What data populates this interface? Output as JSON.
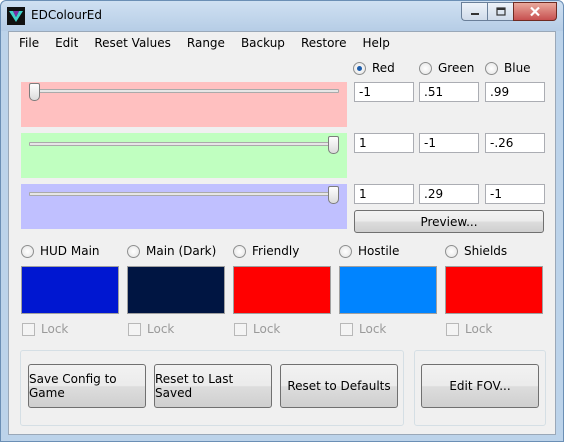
{
  "window": {
    "title": "EDColourEd",
    "buttons": {
      "minimize": "minimize-icon",
      "maximize": "maximize-icon",
      "close": "close-icon"
    }
  },
  "menu": [
    "File",
    "Edit",
    "Reset Values",
    "Range",
    "Backup",
    "Restore",
    "Help"
  ],
  "channels": {
    "selected": "Red",
    "labels": [
      "Red",
      "Green",
      "Blue"
    ]
  },
  "sliders": [
    {
      "name": "red",
      "value": 0.0,
      "color": "#ffc0c0"
    },
    {
      "name": "green",
      "value": 1.0,
      "color": "#c0ffc0"
    },
    {
      "name": "blue",
      "value": 1.0,
      "color": "#c0c0ff"
    }
  ],
  "matrix": [
    [
      "-1",
      ".51",
      ".99"
    ],
    [
      "1",
      "-1",
      "-.26"
    ],
    [
      "1",
      ".29",
      "-1"
    ]
  ],
  "preview_label": "Preview...",
  "elements": [
    {
      "label": "HUD Main",
      "color": "#0017d1",
      "selected": false,
      "lock": "Lock"
    },
    {
      "label": "Main (Dark)",
      "color": "#001542",
      "selected": false,
      "lock": "Lock"
    },
    {
      "label": "Friendly",
      "color": "#ff0000",
      "selected": false,
      "lock": "Lock"
    },
    {
      "label": "Hostile",
      "color": "#0084ff",
      "selected": false,
      "lock": "Lock"
    },
    {
      "label": "Shields",
      "color": "#ff0000",
      "selected": false,
      "lock": "Lock"
    }
  ],
  "actions": {
    "save": "Save Config to Game",
    "reset_last": "Reset to Last Saved",
    "reset_defaults": "Reset to Defaults",
    "edit_fov": "Edit FOV..."
  }
}
